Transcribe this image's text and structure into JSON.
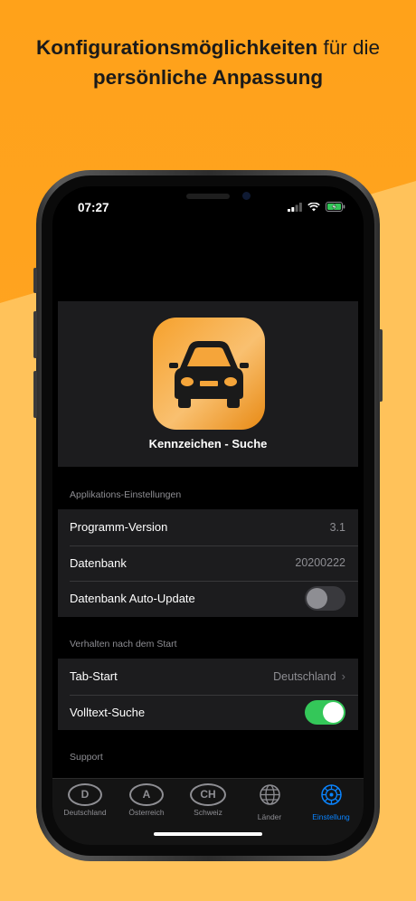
{
  "headline": {
    "bold_part1": "Konfigurationsmöglichkeiten",
    "light_part": "für die",
    "bold_part2": "persönliche Anpassung"
  },
  "status_bar": {
    "time": "07:27",
    "icons": [
      "signal-icon",
      "wifi-icon",
      "battery-charging-icon"
    ]
  },
  "app": {
    "name": "Kennzeichen - Suche",
    "icon": "car-icon"
  },
  "sections": [
    {
      "title": "Applikations-Einstellungen",
      "rows": [
        {
          "label": "Programm-Version",
          "value": "3.1"
        },
        {
          "label": "Datenbank",
          "value": "20200222"
        },
        {
          "label": "Datenbank Auto-Update",
          "toggle": false
        }
      ]
    },
    {
      "title": "Verhalten nach dem Start",
      "rows": [
        {
          "label": "Tab-Start",
          "value": "Deutschland"
        },
        {
          "label": "Volltext-Suche",
          "toggle": true
        }
      ]
    },
    {
      "title": "Support"
    }
  ],
  "tabs": [
    {
      "badge": "D",
      "label": "Deutschland"
    },
    {
      "badge": "A",
      "label": "Österreich"
    },
    {
      "badge": "CH",
      "label": "Schweiz"
    },
    {
      "icon": "globe-icon",
      "label": "Länder"
    },
    {
      "icon": "gear-icon",
      "label": "Einstellung",
      "active": true
    }
  ],
  "colors": {
    "accent": "#0a84ff",
    "toggle_on": "#34c759",
    "background_orange": "#ffa21a"
  }
}
